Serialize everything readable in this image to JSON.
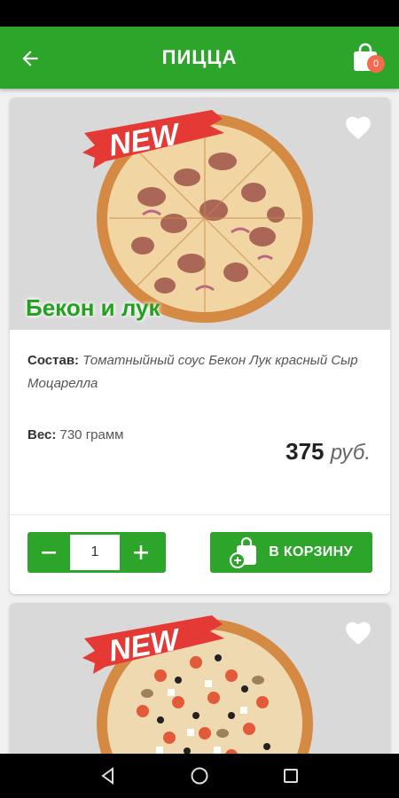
{
  "app_bar": {
    "title": "ПИЦЦА",
    "cart_count": "0"
  },
  "products": [
    {
      "badge": "NEW",
      "name": "Бекон и лук",
      "composition_label": "Состав:",
      "composition": "Томатныйный соус Бекон Лук красный Сыр Моцарелла",
      "weight_label": "Вес:",
      "weight": "730 грамм",
      "price": "375",
      "currency": "руб.",
      "quantity": "1",
      "add_to_cart_label": "В КОРЗИНУ"
    },
    {
      "badge": "NEW"
    }
  ],
  "icons": {
    "back": "arrow-left-icon",
    "cart": "shopping-bag-icon",
    "favorite": "heart-icon",
    "minus": "minus-icon",
    "plus": "plus-icon",
    "add_to_cart": "bag-plus-icon",
    "nav_back": "triangle-back-icon",
    "nav_home": "circle-home-icon",
    "nav_recents": "square-recents-icon"
  },
  "colors": {
    "primary": "#2da52b",
    "name_green": "#22a11f",
    "badge_red": "#e53935",
    "cart_badge": "#f36b4f"
  }
}
